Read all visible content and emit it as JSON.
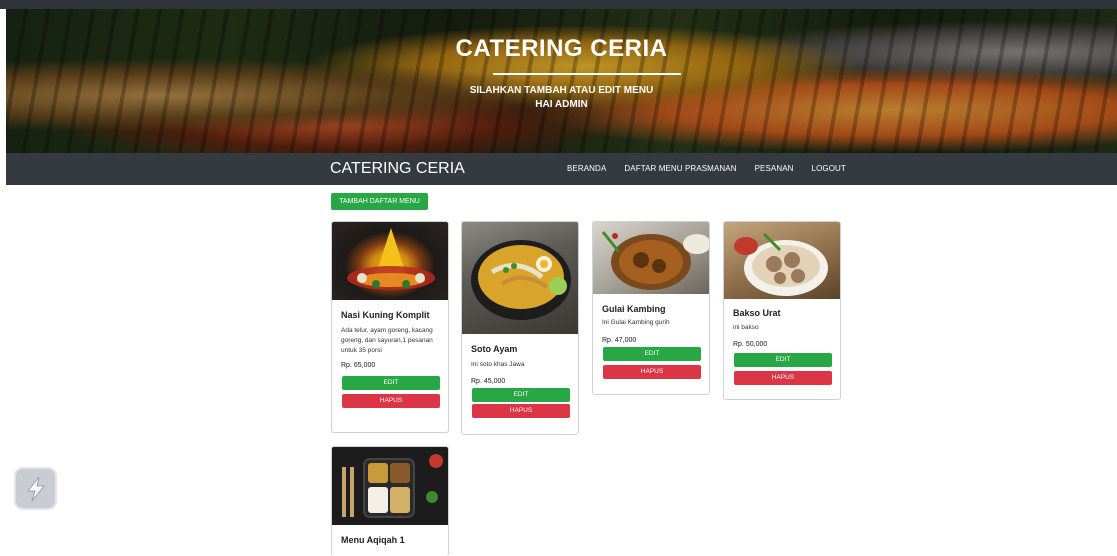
{
  "hero": {
    "title": "CATERING CERIA",
    "subtitle_line1": "SILAHKAN TAMBAH ATAU EDIT MENU",
    "subtitle_line2": "HAI ADMIN"
  },
  "navbar": {
    "brand": "CATERING CERIA",
    "links": [
      "BERANDA",
      "DAFTAR MENU PRASMANAN",
      "PESANAN",
      "LOGOUT"
    ]
  },
  "add_button": "TAMBAH DAFTAR MENU",
  "cards": [
    {
      "title": "Nasi Kuning Komplit",
      "desc": "Ada telur, ayam goreng, kacang goreng, dan sayuran,1 pesanan untuk 35 porsi",
      "price": "Rp. 65,000",
      "edit": "EDIT",
      "delete": "HAPUS"
    },
    {
      "title": "Soto Ayam",
      "desc": "Ini soto khas Jawa",
      "price": "Rp. 45,000",
      "edit": "EDIT",
      "delete": "HAPUS"
    },
    {
      "title": "Gulai Kambing",
      "desc": "Ini Gulai Kambing gurih",
      "price": "Rp. 47,000",
      "edit": "EDIT",
      "delete": "HAPUS"
    },
    {
      "title": "Bakso Urat",
      "desc": "ini bakso",
      "price": "Rp. 50,000",
      "edit": "EDIT",
      "delete": "HAPUS"
    },
    {
      "title": "Menu Aqiqah 1"
    }
  ],
  "icons": {
    "floating": "lightning-app-icon"
  }
}
